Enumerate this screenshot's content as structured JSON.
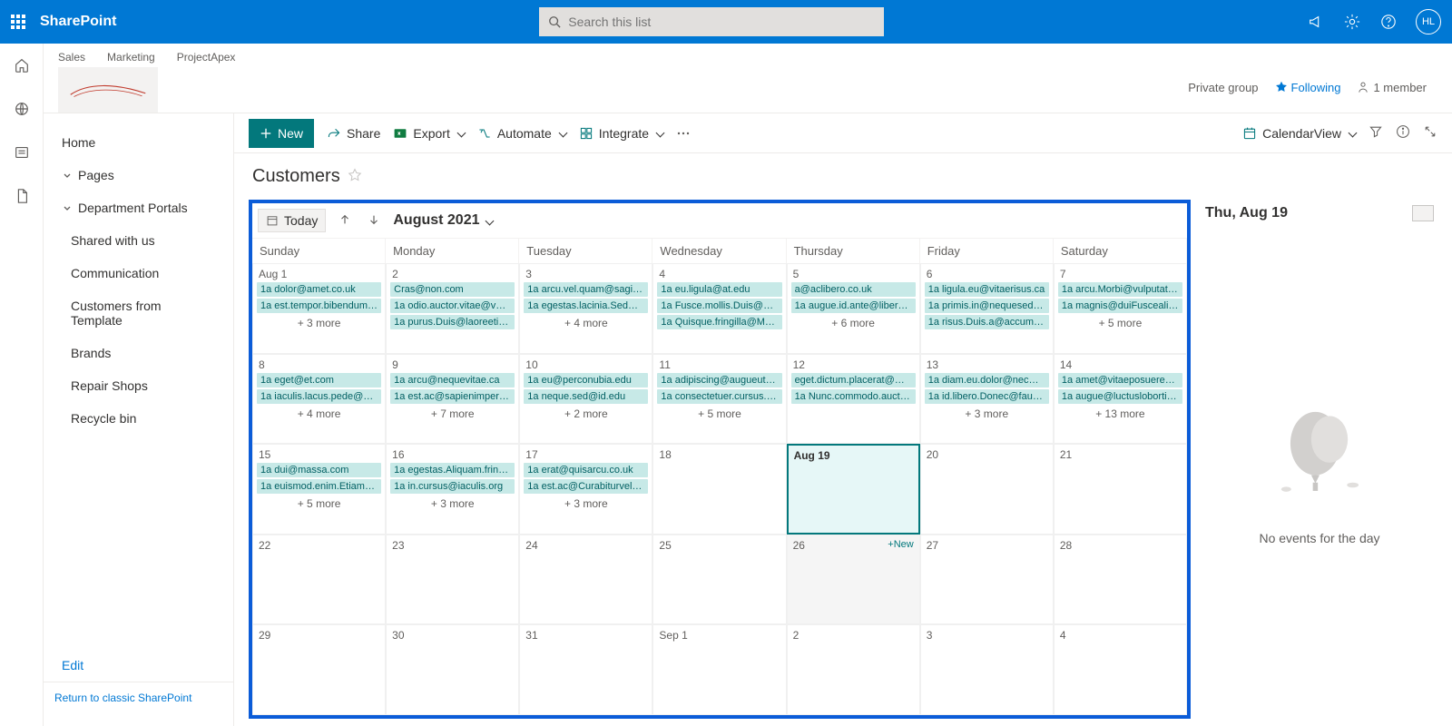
{
  "suite": {
    "title": "SharePoint",
    "search_placeholder": "Search this list",
    "avatar": "HL"
  },
  "site": {
    "tabs": [
      "Sales",
      "Marketing",
      "ProjectApex"
    ],
    "privacy": "Private group",
    "following": "Following",
    "members": "1 member"
  },
  "leftnav": {
    "items": [
      {
        "label": "Home"
      },
      {
        "label": "Pages",
        "chevron": true
      },
      {
        "label": "Department Portals",
        "chevron": true
      },
      {
        "label": "Shared with us",
        "sub": true
      },
      {
        "label": "Communication",
        "sub": true
      },
      {
        "label": "Customers from Template",
        "sub": true
      },
      {
        "label": "Brands",
        "sub": true
      },
      {
        "label": "Repair Shops",
        "sub": true
      },
      {
        "label": "Recycle bin",
        "sub": true
      }
    ],
    "edit": "Edit",
    "footer": "Return to classic SharePoint"
  },
  "cmdbar": {
    "new": "New",
    "share": "Share",
    "export": "Export",
    "automate": "Automate",
    "integrate": "Integrate",
    "view": "CalendarView"
  },
  "list": {
    "title": "Customers"
  },
  "calendar": {
    "today": "Today",
    "month": "August 2021",
    "dows": [
      "Sunday",
      "Monday",
      "Tuesday",
      "Wednesday",
      "Thursday",
      "Friday",
      "Saturday"
    ],
    "hovered_add": "+New",
    "weeks": [
      [
        {
          "label": "Aug 1",
          "events": [
            "1a dolor@amet.co.uk",
            "1a est.tempor.bibendum…"
          ],
          "more": "+ 3 more"
        },
        {
          "label": "2",
          "events": [
            "Cras@non.com",
            "1a odio.auctor.vitae@vel…",
            "1a purus.Duis@laoreetips…"
          ]
        },
        {
          "label": "3",
          "events": [
            "1a arcu.vel.quam@sagitti…",
            "1a egestas.lacinia.Sed@ve…"
          ],
          "more": "+ 4 more"
        },
        {
          "label": "4",
          "events": [
            "1a eu.ligula@at.edu",
            "1a Fusce.mollis.Duis@orci…",
            "1a Quisque.fringilla@Mor…"
          ]
        },
        {
          "label": "5",
          "events": [
            "a@aclibero.co.uk",
            "1a augue.id.ante@libero…"
          ],
          "more": "+ 6 more"
        },
        {
          "label": "6",
          "events": [
            "1a ligula.eu@vitaerisus.ca",
            "1a primis.in@nequesed.org",
            "1a risus.Duis.a@accumsa…"
          ]
        },
        {
          "label": "7",
          "events": [
            "1a arcu.Morbi@vulputate…",
            "1a magnis@duiFuscealiqu…"
          ],
          "more": "+ 5 more"
        }
      ],
      [
        {
          "label": "8",
          "events": [
            "1a eget@et.com",
            "1a iaculis.lacus.pede@ultr…"
          ],
          "more": "+ 4 more"
        },
        {
          "label": "9",
          "events": [
            "1a arcu@nequevitae.ca",
            "1a est.ac@sapienimperdi…"
          ],
          "more": "+ 7 more"
        },
        {
          "label": "10",
          "events": [
            "1a eu@perconubia.edu",
            "1a neque.sed@id.edu"
          ],
          "more": "+ 2 more"
        },
        {
          "label": "11",
          "events": [
            "1a adipiscing@augueut.ca",
            "1a consectetuer.cursus.et…"
          ],
          "more": "+ 5 more"
        },
        {
          "label": "12",
          "events": [
            "eget.dictum.placerat@ma…",
            "1a Nunc.commodo.auctor…"
          ]
        },
        {
          "label": "13",
          "events": [
            "1a diam.eu.dolor@necme…",
            "1a id.libero.Donec@fauci…"
          ],
          "more": "+ 3 more"
        },
        {
          "label": "14",
          "events": [
            "1a amet@vitaeposuereat…",
            "1a augue@luctuslobortis…"
          ],
          "more": "+ 13 more"
        }
      ],
      [
        {
          "label": "15",
          "events": [
            "1a dui@massa.com",
            "1a euismod.enim.Etiam@…"
          ],
          "more": "+ 5 more"
        },
        {
          "label": "16",
          "events": [
            "1a egestas.Aliquam.fringil…",
            "1a in.cursus@iaculis.org"
          ],
          "more": "+ 3 more"
        },
        {
          "label": "17",
          "events": [
            "1a erat@quisarcu.co.uk",
            "1a est.ac@Curabiturvel.co…"
          ],
          "more": "+ 3 more"
        },
        {
          "label": "18",
          "events": []
        },
        {
          "label": "Aug 19",
          "events": [],
          "selected": true
        },
        {
          "label": "20",
          "events": []
        },
        {
          "label": "21",
          "events": []
        }
      ],
      [
        {
          "label": "22",
          "events": []
        },
        {
          "label": "23",
          "events": []
        },
        {
          "label": "24",
          "events": []
        },
        {
          "label": "25",
          "events": []
        },
        {
          "label": "26",
          "events": [],
          "hovered": true
        },
        {
          "label": "27",
          "events": []
        },
        {
          "label": "28",
          "events": []
        }
      ],
      [
        {
          "label": "29",
          "events": []
        },
        {
          "label": "30",
          "events": []
        },
        {
          "label": "31",
          "events": []
        },
        {
          "label": "Sep 1",
          "events": []
        },
        {
          "label": "2",
          "events": []
        },
        {
          "label": "3",
          "events": []
        },
        {
          "label": "4",
          "events": []
        }
      ]
    ]
  },
  "side": {
    "title": "Thu, Aug 19",
    "empty": "No events for the day"
  }
}
